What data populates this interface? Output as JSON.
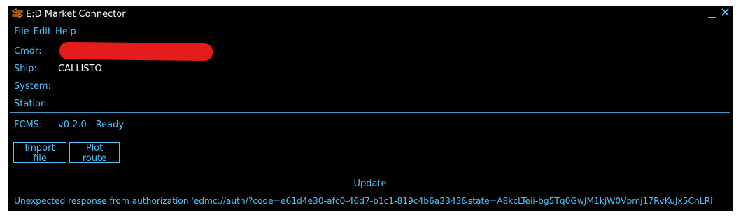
{
  "window": {
    "title": "E:D Market Connector",
    "icons": {
      "app": "edmc-logo-icon",
      "minimize": "minimize-icon",
      "close": "close-icon"
    },
    "close_glyph": "✕"
  },
  "menu": [
    "File",
    "Edit",
    "Help"
  ],
  "fields": {
    "cmdr": {
      "label": "Cmdr:",
      "value": ""
    },
    "ship": {
      "label": "Ship:",
      "value": "CALLISTO"
    },
    "system": {
      "label": "System:",
      "value": ""
    },
    "station": {
      "label": "Station:",
      "value": ""
    }
  },
  "plugin": {
    "label": "FCMS:",
    "value": "v0.2.0 - Ready"
  },
  "buttons": {
    "import": "Import file",
    "plot": "Plot route"
  },
  "update_label": "Update",
  "status": "Unexpected response from authorization 'edmc://auth/?code=e61d4e30-afc0-46d7-b1c1-819c4b6a2343&state=A8kcLTeii-bg5Tq0GwJM1kjW0Vpmj17RvKuJx5CnLRI'",
  "colors": {
    "accent": "#4fc3ff",
    "background": "#000000",
    "text_light": "#ffffff",
    "redaction": "#e51c1c"
  }
}
